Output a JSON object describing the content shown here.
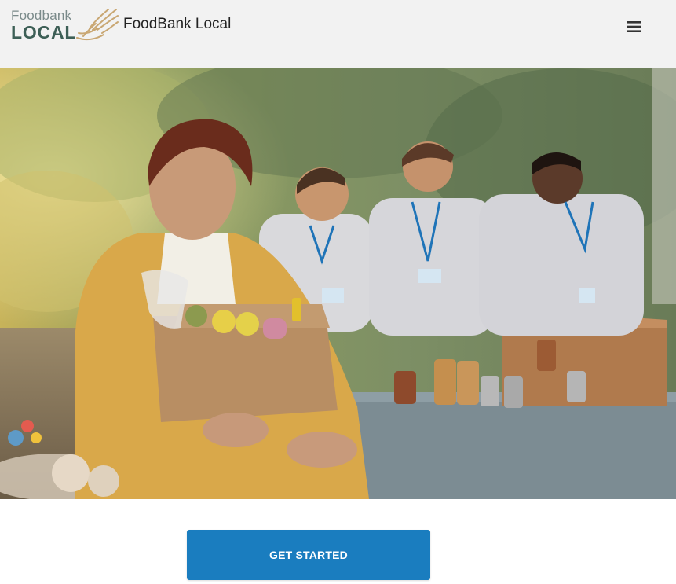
{
  "header": {
    "logo_top": "Foodbank",
    "logo_bottom": "LOCAL",
    "site_title": "FoodBank Local",
    "menu_icon": "hamburger-menu-icon"
  },
  "hero": {
    "icon": "hero-photo-volunteers-food-donation"
  },
  "cta": {
    "label": "GET STARTED"
  },
  "colors": {
    "header_bg": "#f2f2f2",
    "brand_green": "#3d5f56",
    "logo_gold": "#c9a773",
    "cta_blue": "#1a7dbf"
  }
}
